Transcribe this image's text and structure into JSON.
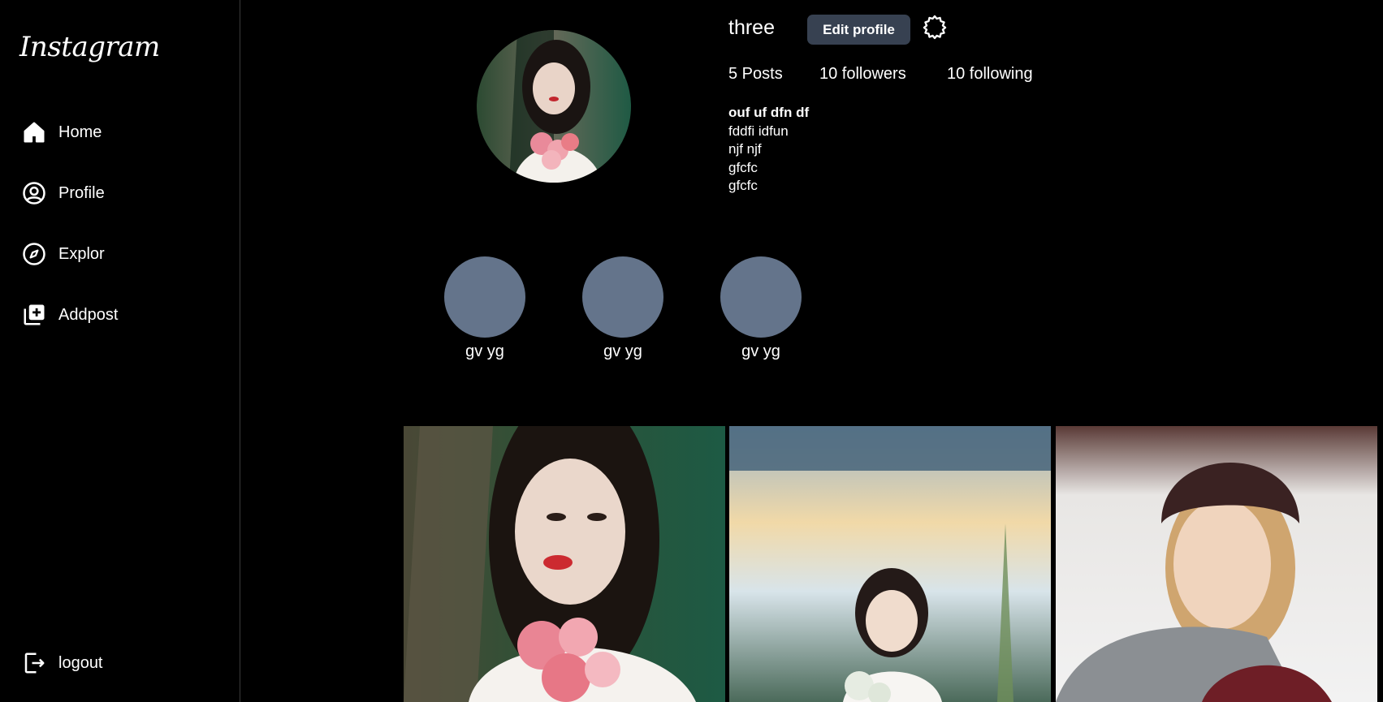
{
  "sidebar": {
    "logo": "Instagram",
    "items": [
      {
        "label": "Home",
        "icon": "home-icon"
      },
      {
        "label": "Profile",
        "icon": "profile-icon"
      },
      {
        "label": "Explor",
        "icon": "compass-icon"
      },
      {
        "label": "Addpost",
        "icon": "add-post-icon"
      }
    ],
    "logout": {
      "label": "logout",
      "icon": "logout-icon"
    }
  },
  "profile": {
    "username": "three",
    "edit_label": "Edit profile",
    "settings_icon": "settings-icon",
    "stats": {
      "posts": "5 Posts",
      "followers": "10 followers",
      "following": "10 following"
    },
    "bio": {
      "name": "ouf uf dfn df",
      "lines": [
        "fddfi idfun",
        "njf njf",
        "gfcfc",
        "gfcfc"
      ]
    }
  },
  "highlights": [
    {
      "label": "gv yg"
    },
    {
      "label": "gv yg"
    },
    {
      "label": "gv yg"
    }
  ],
  "colors": {
    "background": "#000000",
    "button": "#374151",
    "highlight_circle": "#64748b",
    "divider": "#3a3a3a"
  }
}
